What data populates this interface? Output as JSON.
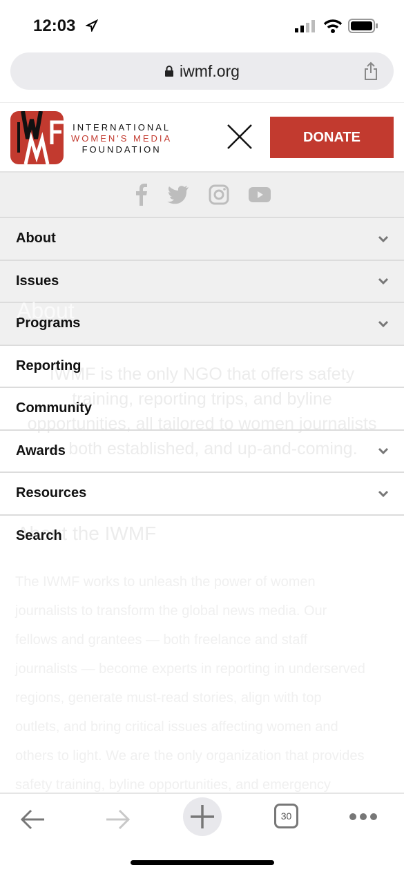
{
  "status_bar": {
    "time": "12:03"
  },
  "browser": {
    "url": "iwmf.org",
    "tab_count": "30"
  },
  "header": {
    "logo_lines": [
      "INTERNATIONAL",
      "WOMEN'S MEDIA",
      "FOUNDATION"
    ],
    "logo_letters": "IWMF",
    "donate_label": "DONATE",
    "brand_color": "#c23a2f"
  },
  "social": [
    "facebook-icon",
    "twitter-icon",
    "instagram-icon",
    "youtube-icon"
  ],
  "menu": {
    "items": [
      {
        "label": "About",
        "expandable": true
      },
      {
        "label": "Issues",
        "expandable": true
      },
      {
        "label": "Programs",
        "expandable": true
      },
      {
        "label": "Reporting",
        "expandable": false
      },
      {
        "label": "Community",
        "expandable": false
      },
      {
        "label": "Awards",
        "expandable": true
      },
      {
        "label": "Resources",
        "expandable": true
      },
      {
        "label": "Search",
        "expandable": false
      }
    ]
  },
  "background_page": {
    "hero_title": "About",
    "intro": [
      "IWMF is the only NGO that offers safety",
      "training, reporting trips, and byline",
      "opportunities, all tailored to women journalists",
      "— both established, and up-and-coming."
    ],
    "section_title": "About the IWMF",
    "body": [
      "The IWMF works to unleash the power of women",
      "journalists to transform the global news media. Our",
      "fellows and grantees — both freelance and staff",
      "journalists — become experts in reporting in underserved",
      "regions, generate must-read stories, align with top",
      "outlets, and bring critical issues affecting women and",
      "others to light. We are the only organization that provides",
      "safety training, byline opportunities, and emergency"
    ]
  }
}
